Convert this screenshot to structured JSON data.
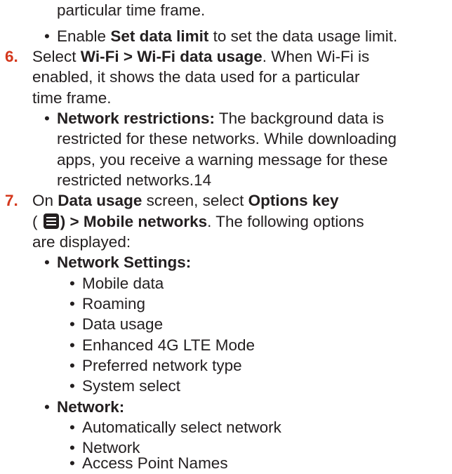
{
  "accent_color": "#d4371c",
  "bullet_char": "•",
  "steps": {
    "cont_line": "particular time frame.",
    "b1": {
      "bold": "Set data limit",
      "pre": "Enable ",
      "post": " to set the data usage limit."
    },
    "s6": {
      "number": "6.",
      "l1": {
        "pre": "Select ",
        "bold": "Wi-Fi > Wi-Fi data usage",
        "post": ". When Wi-Fi is"
      },
      "l2": "enabled, it shows the data used for a particular",
      "l3": "time frame.",
      "b": {
        "bold": "Network restrictions:",
        "post": " The background data is"
      },
      "b2": "restricted for these networks. While downloading",
      "b3": "apps, you receive a warning message for these",
      "b4": "restricted networks.14"
    },
    "s7": {
      "number": "7.",
      "l1": {
        "pre": "On ",
        "bold1": "Data usage",
        "mid": " screen, select ",
        "bold2": "Options key"
      },
      "l2": {
        "open": "( ",
        "bold": ") > Mobile networks",
        "post": ". The following options"
      },
      "l3": "are displayed:",
      "group1": {
        "label": "Network Settings:",
        "items": [
          "Mobile data",
          "Roaming",
          "Data usage",
          "Enhanced 4G LTE Mode",
          "Preferred network type",
          "System select"
        ]
      },
      "group2": {
        "label": "Network:",
        "items": [
          "Automatically select network",
          "Network",
          "Access Point Names"
        ]
      }
    }
  }
}
